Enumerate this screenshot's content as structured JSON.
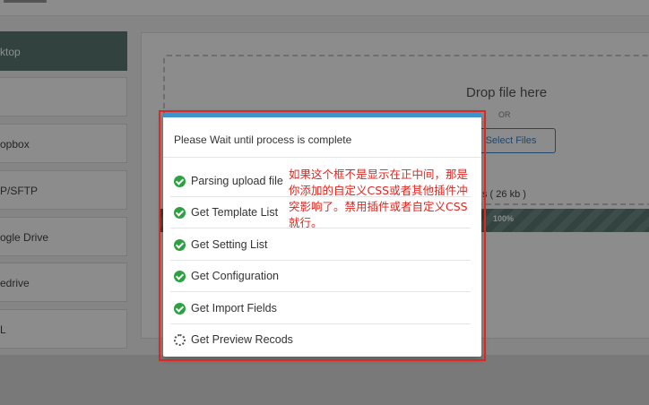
{
  "sidebar": {
    "items": [
      {
        "label": "ktop",
        "active": true
      },
      {
        "label": "",
        "active": false
      },
      {
        "label": "opbox",
        "active": false
      },
      {
        "label": "P/SFTP",
        "active": false
      },
      {
        "label": "ogle Drive",
        "active": false
      },
      {
        "label": "edrive",
        "active": false
      },
      {
        "label": "L",
        "active": false
      }
    ]
  },
  "dropzone": {
    "title": "Drop file here",
    "or_label": "OR",
    "select_button": "Select Files"
  },
  "upload": {
    "file_size_label": "s ( 26 kb )",
    "progress_percent": 100,
    "progress_label": "100%"
  },
  "modal": {
    "header": "Please Wait until process is complete",
    "steps": [
      {
        "label": "Parsing upload file",
        "status": "done"
      },
      {
        "label": "Get Template List",
        "status": "done"
      },
      {
        "label": "Get Setting List",
        "status": "done"
      },
      {
        "label": "Get Configuration",
        "status": "done"
      },
      {
        "label": "Get Import Fields",
        "status": "done"
      },
      {
        "label": "Get Preview Recods",
        "status": "loading"
      }
    ]
  },
  "annotation": {
    "text": "如果这个框不是显示在正中间，那是你添加的自定义CSS或者其他插件冲突影响了。禁用插件或者自定义CSS就行。",
    "color": "#e0261f"
  },
  "colors": {
    "accent": "#5b7a73",
    "modal_top": "#3f93c9",
    "success": "#2ea043"
  }
}
